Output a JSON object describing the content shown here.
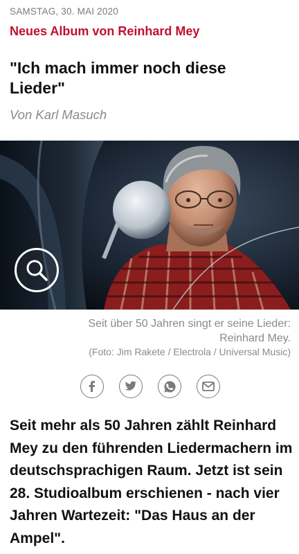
{
  "article": {
    "date": "SAMSTAG, 30. MAI 2020",
    "kicker": "Neues Album von Reinhard Mey",
    "headline": "\"Ich mach immer noch diese Lieder\"",
    "byline": "Von Karl Masuch"
  },
  "image": {
    "caption": "Seit über 50 Jahren singt er seine Lieder: Reinhard Mey.",
    "credit": "(Foto: Jim Rakete / Electrola / Universal Music)",
    "zoom_icon": "magnifier-icon"
  },
  "share": {
    "icons": [
      "facebook-icon",
      "twitter-icon",
      "whatsapp-icon",
      "email-icon"
    ],
    "colors": {
      "icon": "#7a7a7a"
    }
  },
  "lead": "Seit mehr als 50 Jahren zählt Reinhard Mey zu den führenden Liedermachern im deutschsprachigen Raum. Jetzt ist sein 28. Studioalbum erschienen - nach vier Jahren Wartezeit: \"Das Haus an der Ampel\".",
  "colors": {
    "kicker": "#c20f2f",
    "muted": "#8a8a8a"
  }
}
